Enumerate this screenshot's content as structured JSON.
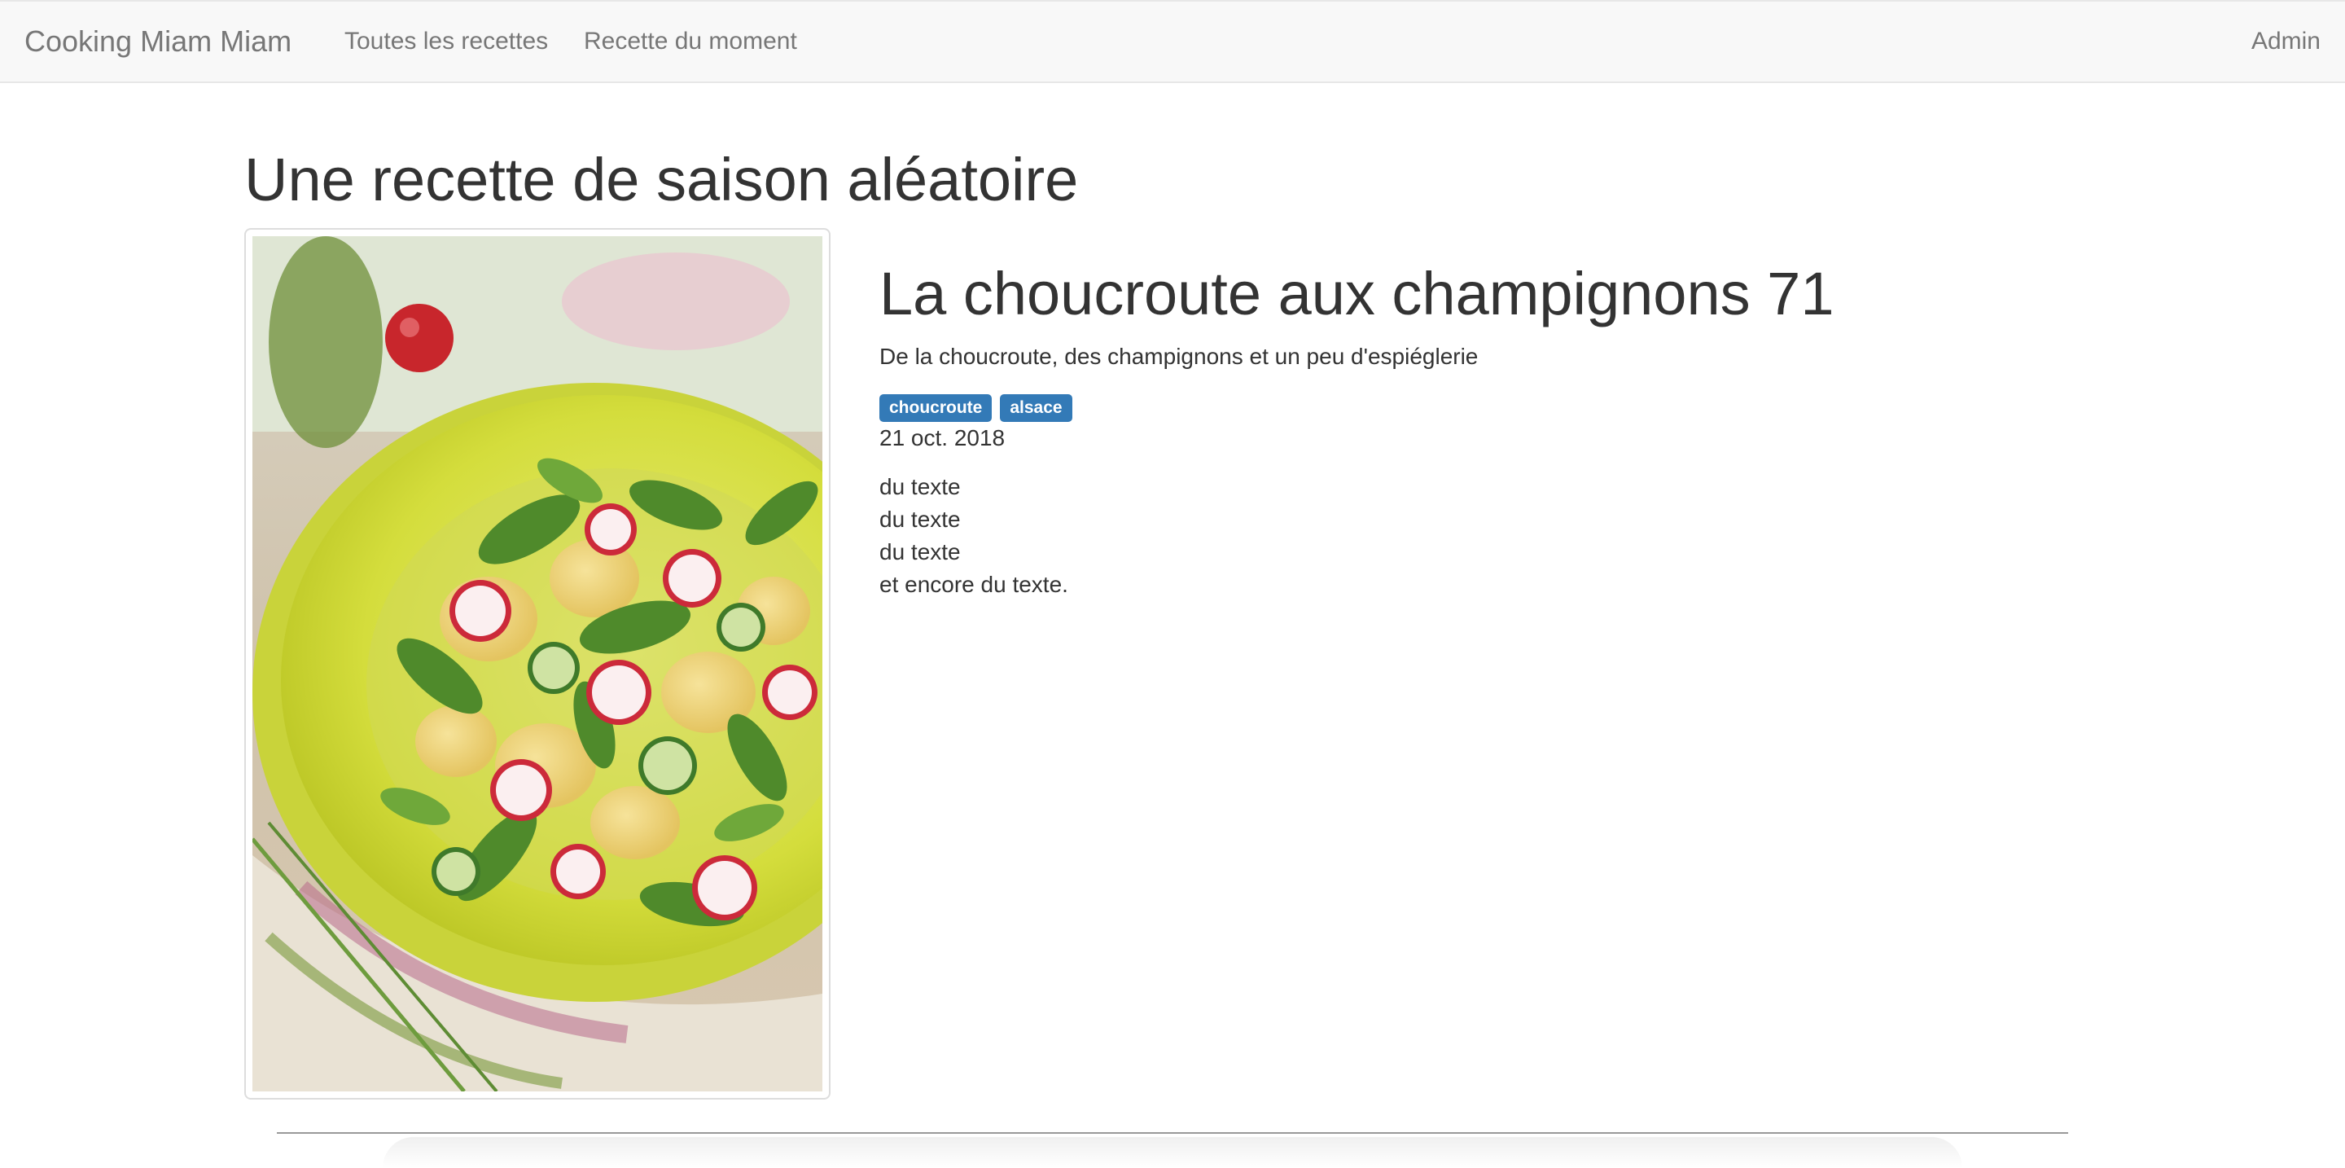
{
  "navbar": {
    "brand": "Cooking Miam Miam",
    "links": [
      "Toutes les recettes",
      "Recette du moment"
    ],
    "admin": "Admin"
  },
  "page": {
    "title": "Une recette de saison aléatoire"
  },
  "recipe": {
    "title": "La choucroute aux champignons 71",
    "description": "De la choucroute, des champignons et un peu d'espiéglerie",
    "tags": [
      "choucroute",
      "alsace"
    ],
    "date": "21 oct. 2018",
    "body": [
      "du texte",
      "du texte",
      "du texte",
      "et encore du texte."
    ]
  },
  "colors": {
    "tag": "#337ab7",
    "navbar_bg": "#f8f8f8",
    "nav_text": "#777777",
    "text": "#333333"
  }
}
